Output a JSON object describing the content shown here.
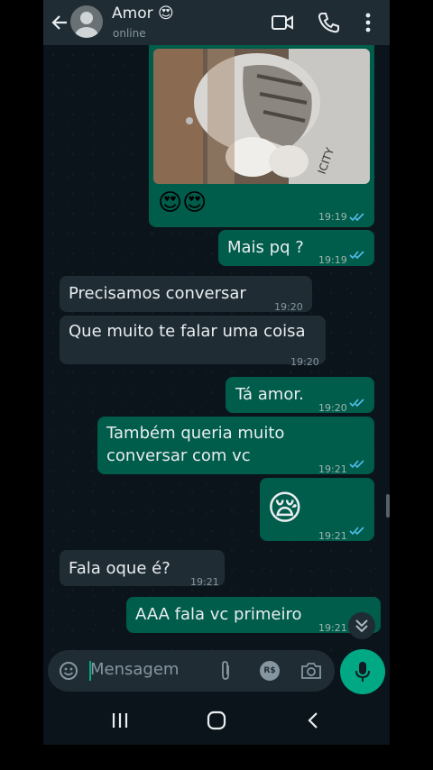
{
  "header": {
    "contact_name": "Amor",
    "contact_status": "online",
    "icons": [
      "back-arrow-icon",
      "avatar",
      "video-call-icon",
      "voice-call-icon",
      "more-options-icon"
    ]
  },
  "messages": {
    "image_msg": {
      "emojis": "😍😍",
      "time": "19:19"
    },
    "m1": {
      "text": "Mais pq ?",
      "time": "19:19"
    },
    "m2": {
      "text": "Precisamos conversar",
      "time": "19:20"
    },
    "m3": {
      "text": "Que muito te falar uma coisa",
      "time": "19:20"
    },
    "m4": {
      "text": "Tá amor.",
      "time": "19:20"
    },
    "m5": {
      "line1": "Também queria muito",
      "line2": "conversar com vc",
      "time": "19:21"
    },
    "m6": {
      "emoji": "😪",
      "time": "19:21"
    },
    "m7": {
      "text": "Fala oque é?",
      "time": "19:21"
    },
    "m8": {
      "text": "AAA fala vc primeiro",
      "time": "19:21"
    }
  },
  "input": {
    "placeholder": "Mensagem",
    "payment_symbol": "R$"
  },
  "colors": {
    "outgoing_bubble": "#005c4b",
    "incoming_bubble": "#1f2c34",
    "accent": "#00a884",
    "read_ticks": "#53bdeb"
  }
}
